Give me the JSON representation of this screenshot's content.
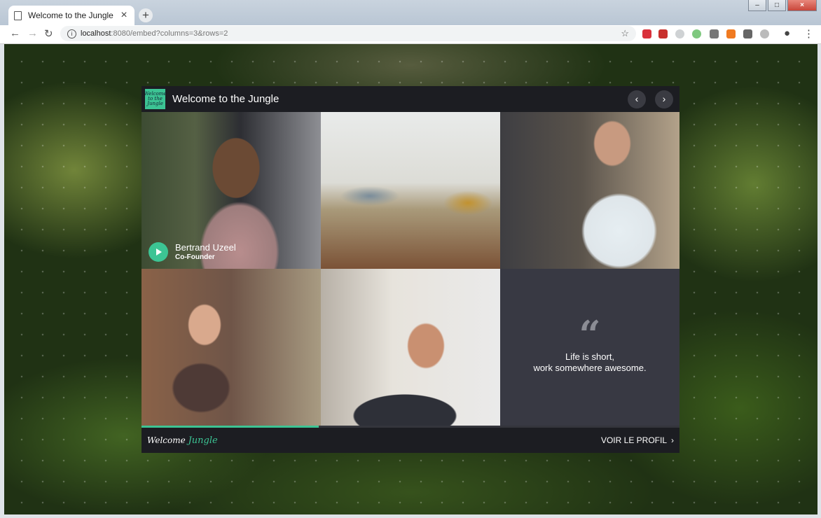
{
  "browser": {
    "tab_title": "Welcome to the Jungle",
    "url_host": "localhost",
    "url_rest": ":8080/embed?columns=3&rows=2"
  },
  "widget": {
    "logo_text": "Welcome to the Jungle",
    "title": "Welcome to the Jungle",
    "progress": 0.33,
    "person": {
      "name": "Bertrand Uzeel",
      "role": "Co-Founder"
    },
    "quote": {
      "line1": "Life is short,",
      "line2": "work somewhere awesome."
    },
    "footer_logo": "Welcome",
    "footer_logo_accent": "Jungle",
    "profile_link": "VOIR LE PROFIL"
  },
  "icons": {
    "tab": "document-icon",
    "accent_color": "#3cc494"
  }
}
